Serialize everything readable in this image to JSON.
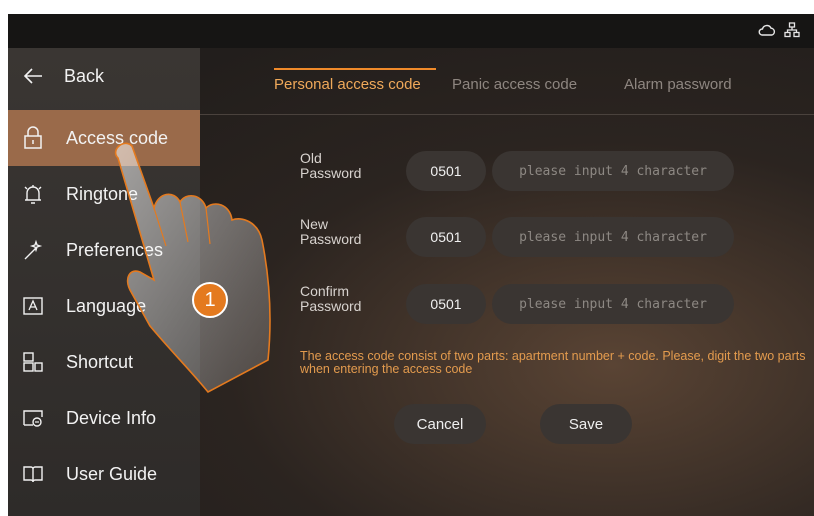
{
  "sidebar": {
    "back_label": "Back",
    "items": [
      {
        "label": "Access code",
        "icon": "lock-icon"
      },
      {
        "label": "Ringtone",
        "icon": "bell-icon"
      },
      {
        "label": "Preferences",
        "icon": "magic-wand-icon"
      },
      {
        "label": "Language",
        "icon": "language-icon"
      },
      {
        "label": "Shortcut",
        "icon": "shortcut-icon"
      },
      {
        "label": "Device Info",
        "icon": "device-info-icon"
      },
      {
        "label": "User Guide",
        "icon": "book-icon"
      }
    ]
  },
  "tabs": [
    {
      "label": "Personal access code",
      "active": true
    },
    {
      "label": "Panic access code",
      "active": false
    },
    {
      "label": "Alarm password",
      "active": false
    }
  ],
  "form": {
    "rows": [
      {
        "label_line1": "Old",
        "label_line2": "Password",
        "value": "0501",
        "placeholder": "please input 4 character"
      },
      {
        "label_line1": "New",
        "label_line2": "Password",
        "value": "0501",
        "placeholder": "please input 4 character"
      },
      {
        "label_line1": "Confirm",
        "label_line2": "Password",
        "value": "0501",
        "placeholder": "please input 4 character"
      }
    ],
    "hint": "The access code consist of two parts: apartment number + code. Please, digit the two parts when entering the access code",
    "cancel_label": "Cancel",
    "save_label": "Save"
  },
  "annotation": {
    "step_number": "1"
  },
  "colors": {
    "accent": "#f08a2a",
    "active_item": "#9a6a4a",
    "hint": "#e39b4e"
  }
}
